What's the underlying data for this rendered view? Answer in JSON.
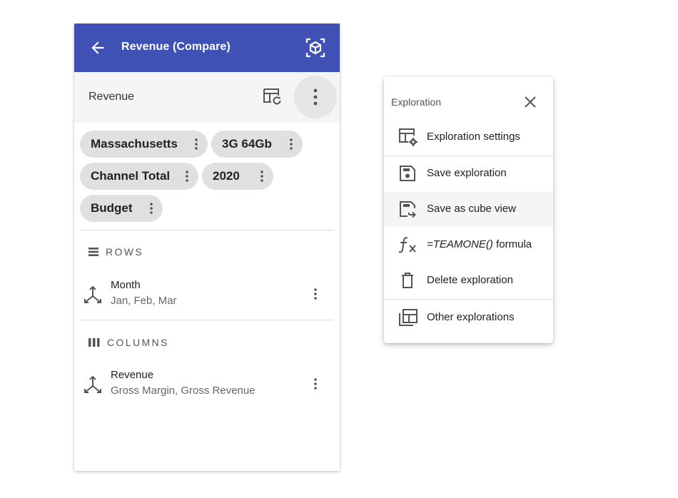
{
  "appbar": {
    "title": "Revenue (Compare)",
    "color": "#3f51b5"
  },
  "subbar": {
    "label": "Revenue"
  },
  "chips": [
    {
      "label": "Massachusetts"
    },
    {
      "label": "3G 64Gb"
    },
    {
      "label": "Channel Total"
    },
    {
      "label": "2020"
    },
    {
      "label": "Budget"
    }
  ],
  "rows": {
    "heading": "ROWS",
    "dimension": {
      "name": "Month",
      "members": "Jan, Feb, Mar"
    }
  },
  "columns": {
    "heading": "COLUMNS",
    "dimension": {
      "name": "Revenue",
      "members": "Gross Margin, Gross Revenue"
    }
  },
  "menu": {
    "title": "Exploration",
    "items": [
      {
        "label": "Exploration settings",
        "icon": "table-gear-icon"
      },
      {
        "label": "Save exploration",
        "icon": "save-icon"
      },
      {
        "label": "Save as cube view",
        "icon": "save-as-icon"
      },
      {
        "label_formula": "=TEAMONE()",
        "label_rest": " formula",
        "icon": "function-icon"
      },
      {
        "label": "Delete exploration",
        "icon": "trash-icon"
      },
      {
        "label": "Other explorations",
        "icon": "library-icon"
      }
    ]
  }
}
